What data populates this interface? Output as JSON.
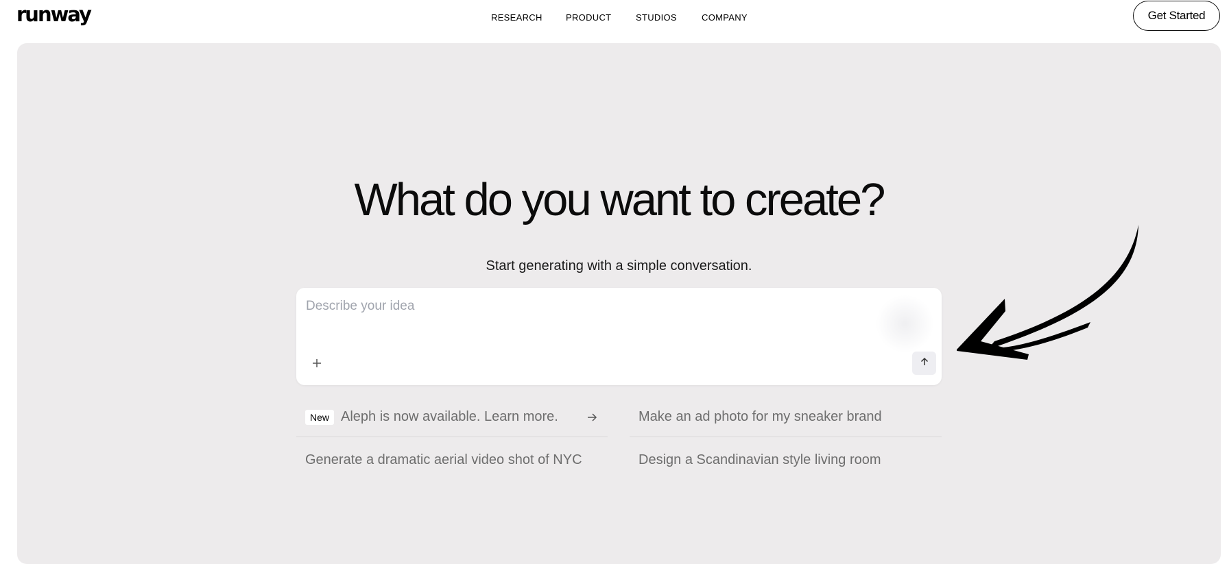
{
  "header": {
    "logo": "runway",
    "nav": [
      "RESEARCH",
      "PRODUCT",
      "STUDIOS",
      "COMPANY"
    ],
    "cta_label": "Get Started"
  },
  "hero": {
    "headline": "What do you want to create?",
    "subhead": "Start generating with a simple conversation.",
    "prompt_placeholder": "Describe your idea",
    "suggestions": [
      {
        "badge": "New",
        "text": "Aleph is now available. Learn more."
      },
      {
        "text": "Make an ad photo for my sneaker brand"
      },
      {
        "text": "Generate a dramatic aerial video shot of NYC"
      },
      {
        "text": "Design a Scandinavian style living room"
      }
    ]
  },
  "icons": {
    "attach": "plus-icon",
    "send": "arrow-up-icon",
    "suggestion_go": "arrow-right-icon",
    "annotation": "curved-arrow-icon"
  },
  "colors": {
    "hero_bg": "#edebec",
    "text": "#111111",
    "muted": "#6e6e6e",
    "placeholder": "#a0a4ad"
  }
}
